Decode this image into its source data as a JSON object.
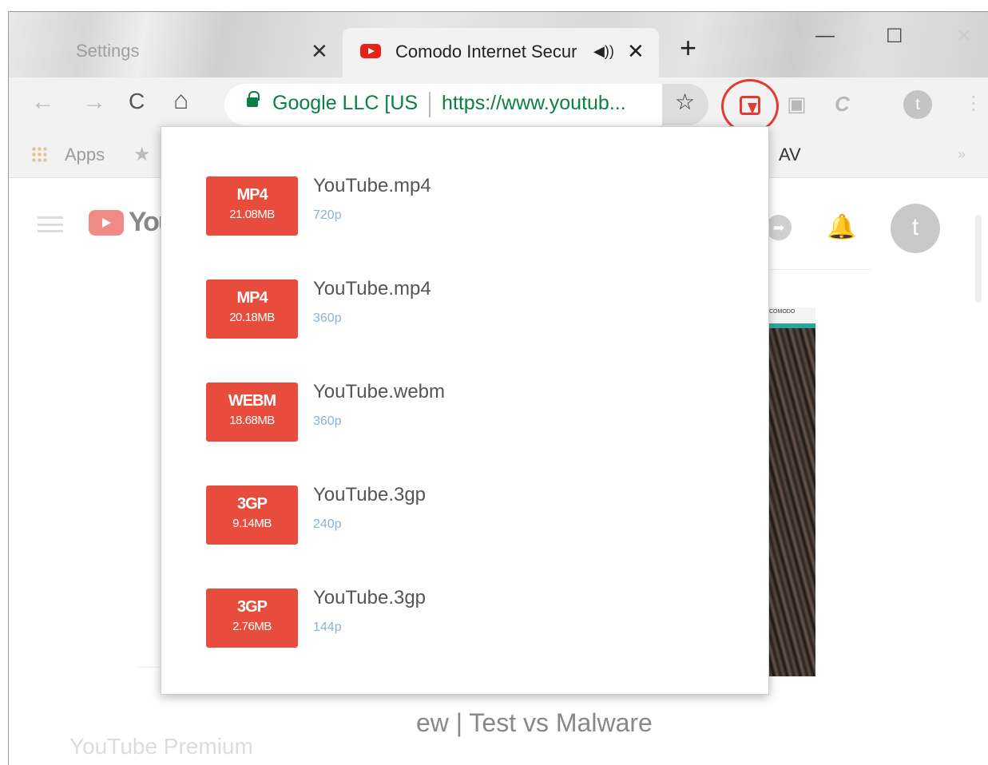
{
  "tabs": {
    "inactive": {
      "title": "Settings",
      "close": "✕"
    },
    "active": {
      "title": "Comodo Internet Secur",
      "audio": "◀))",
      "close": "✕"
    },
    "new_tab": "+"
  },
  "window_controls": {
    "minimize": "—",
    "maximize": "☐",
    "close": "✕"
  },
  "toolbar": {
    "back": "←",
    "forward": "→",
    "reload": "C",
    "home": "⌂",
    "origin": "Google LLC [US",
    "url": "https://www.youtub...",
    "star": "☆",
    "profile_initial": "t",
    "menu": "⋮"
  },
  "bookmarks": {
    "apps_label": "Apps",
    "star": "★",
    "av_label": "AV",
    "more": "»"
  },
  "page": {
    "logo_text": "You",
    "avatar_initial": "t",
    "video_title": "ew | Test vs Malware",
    "premium_label": "YouTube Premium",
    "thumb_brand": "COMODO",
    "bottom_actions": "",
    "share_icon": "➦",
    "bell_icon": "🔔"
  },
  "downloads": [
    {
      "format": "MP4",
      "size": "21.08MB",
      "filename": "YouTube.mp4",
      "resolution": "720p"
    },
    {
      "format": "MP4",
      "size": "20.18MB",
      "filename": "YouTube.mp4",
      "resolution": "360p"
    },
    {
      "format": "WEBM",
      "size": "18.68MB",
      "filename": "YouTube.webm",
      "resolution": "360p"
    },
    {
      "format": "3GP",
      "size": "9.14MB",
      "filename": "YouTube.3gp",
      "resolution": "240p"
    },
    {
      "format": "3GP",
      "size": "2.76MB",
      "filename": "YouTube.3gp",
      "resolution": "144p"
    }
  ],
  "colors": {
    "badge": "#e74c3c",
    "highlight_ring": "#e53935",
    "secure_green": "#0b8043",
    "resolution_blue": "#8fb0d6"
  }
}
